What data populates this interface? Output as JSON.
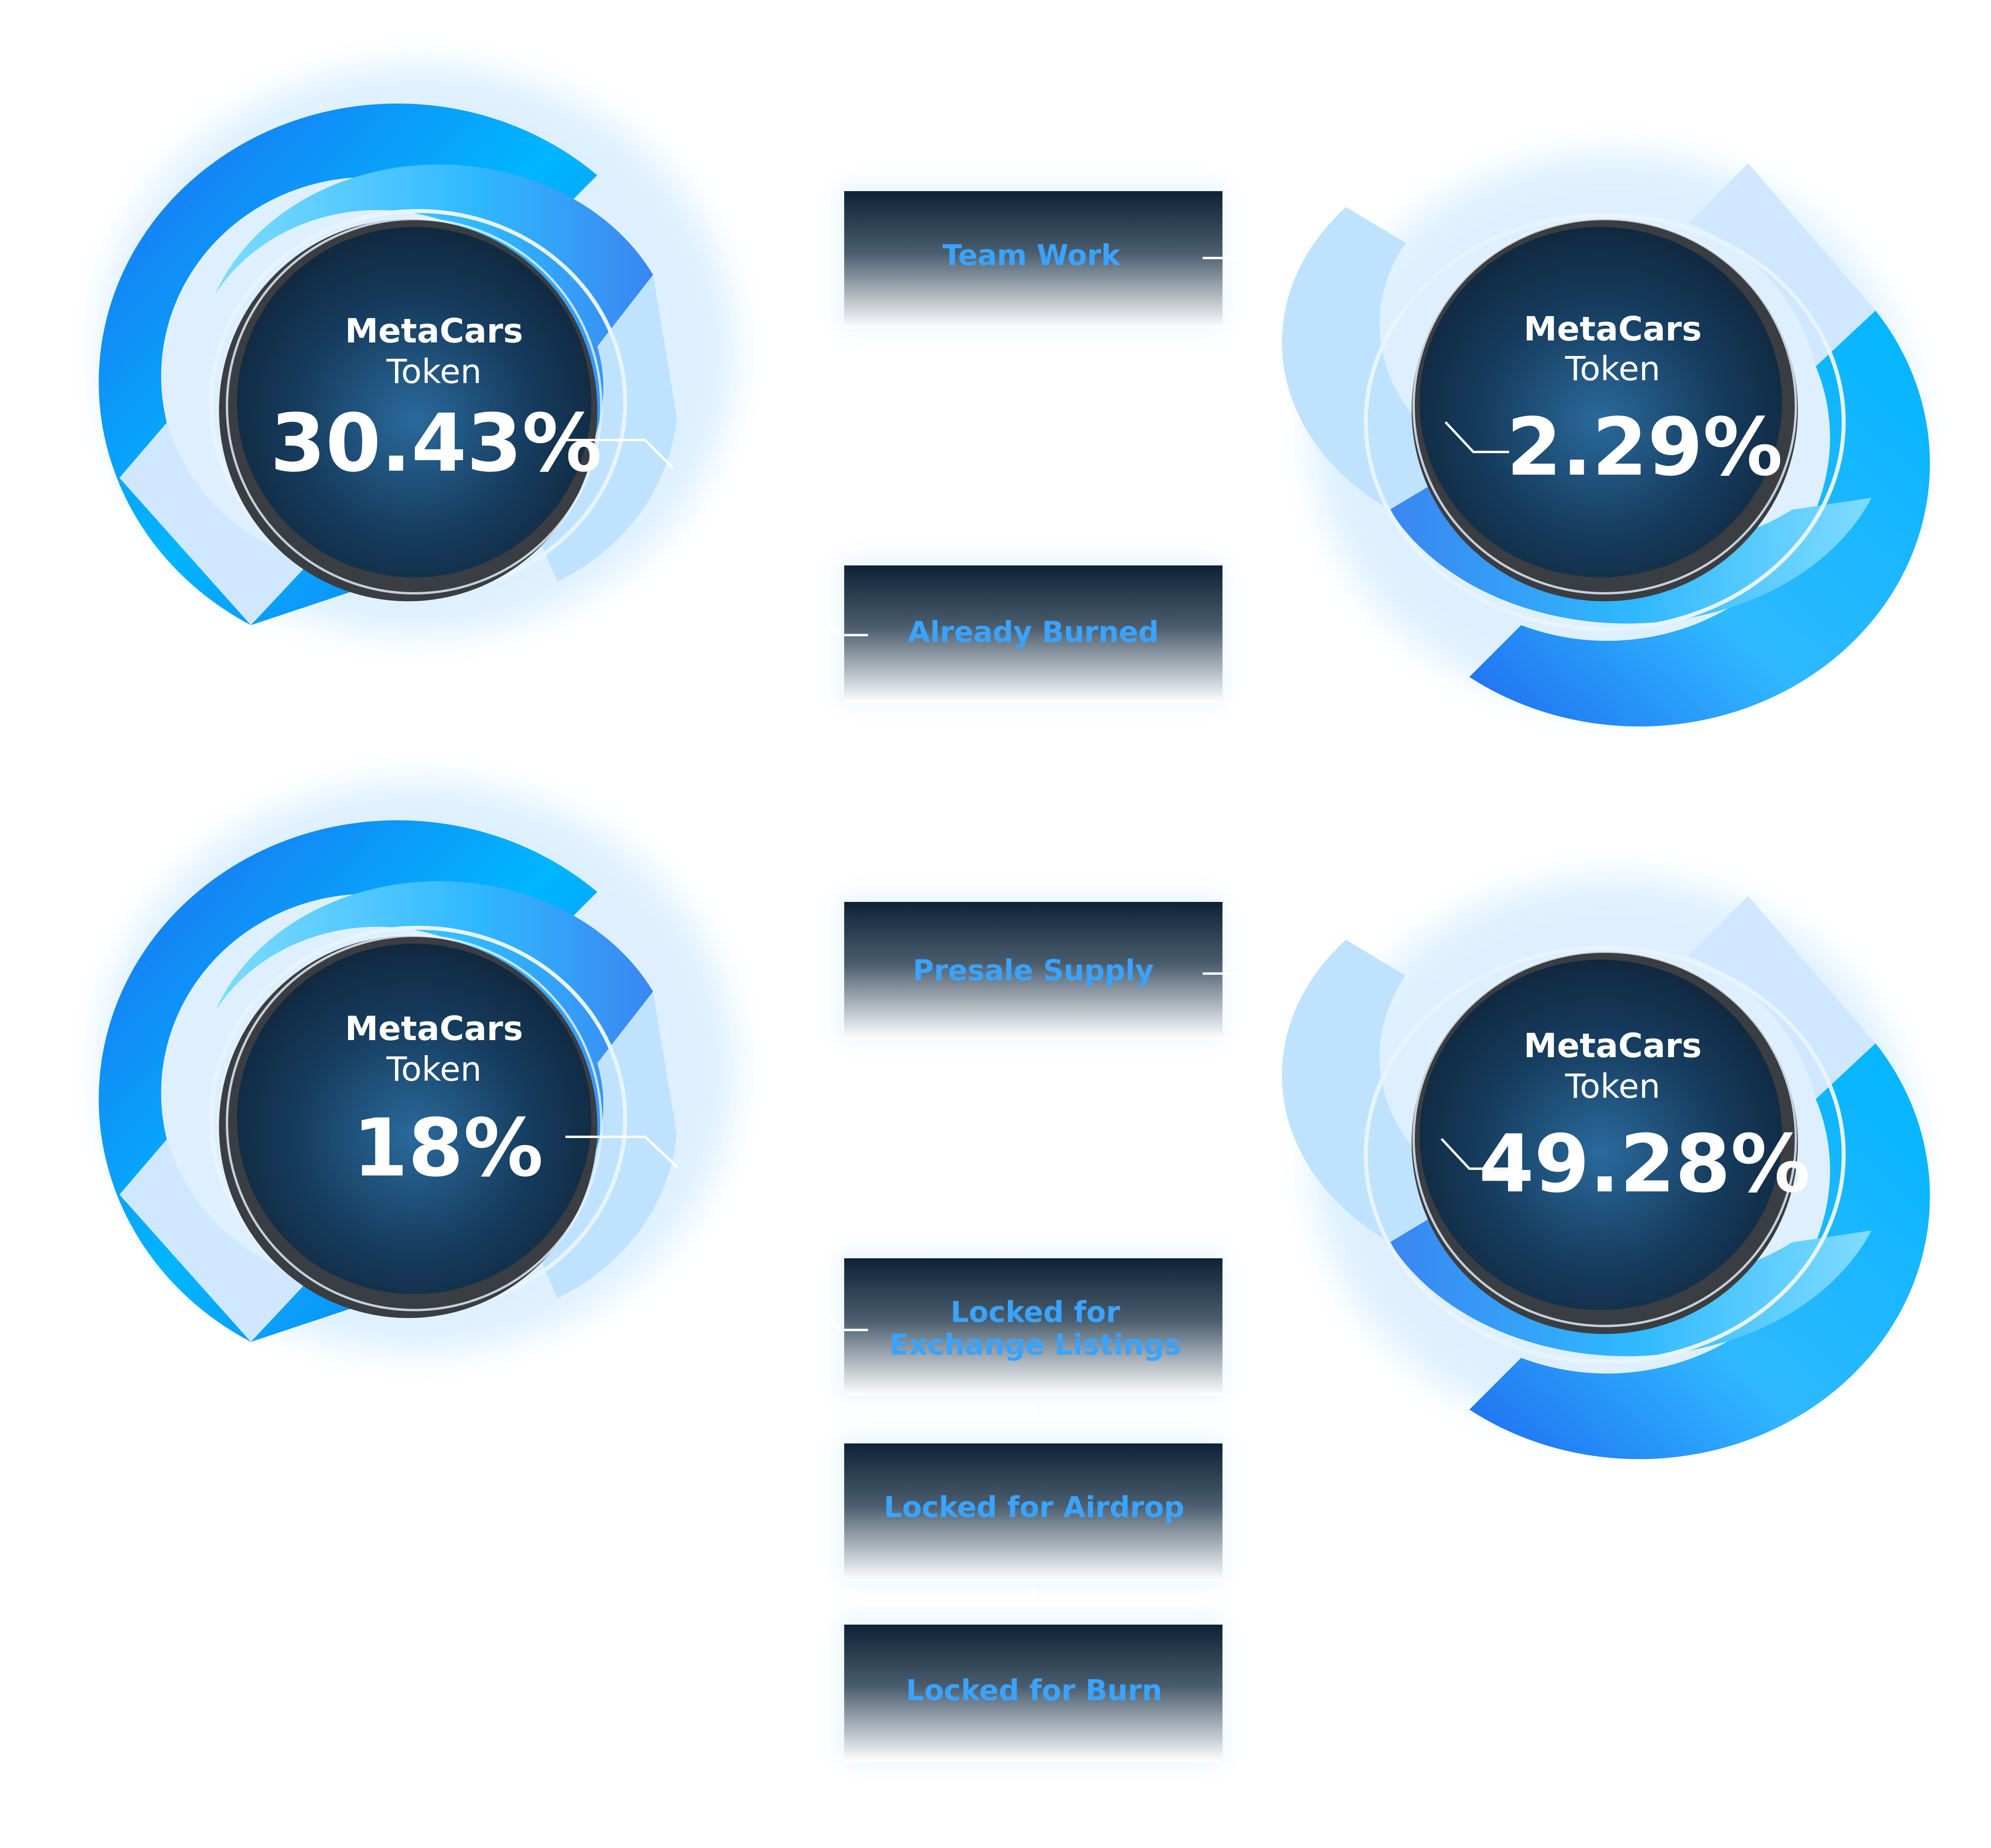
{
  "token_cards": [
    {
      "brand": "MetaCars",
      "unit": "Token",
      "percent_label": "30.43%",
      "share": 30.43,
      "category": "Team Work"
    },
    {
      "brand": "MetaCars",
      "unit": "Token",
      "percent_label": "2.29%",
      "share": 2.29,
      "category": "Already Burned"
    },
    {
      "brand": "MetaCars",
      "unit": "Token",
      "percent_label": "18%",
      "share": 18,
      "category": "Presale Supply"
    },
    {
      "brand": "MetaCars",
      "unit": "Token",
      "percent_label": "49.28%",
      "share": 49.28,
      "category": "Locked for Exchange Listings + Locked for Airdrop + Locked for Burn"
    }
  ],
  "categories": {
    "team_work": "Team Work",
    "already_burned": "Already Burned",
    "presale_supply": "Presale Supply",
    "locked_exchange_line1": "Locked for",
    "locked_exchange_line2": "Exchange Listings",
    "locked_airdrop": "Locked for Airdrop",
    "locked_burn": "Locked for Burn"
  },
  "colors": {
    "ring_deep": "#1e6cf0",
    "ring_mid": "#2fb8ff",
    "ring_light": "#bfe3ff",
    "disc_center": "#2a6a9c",
    "disc_edge": "#0f2438",
    "disc_rim": "#3a3d42",
    "label_blue": "#3aa3ff",
    "box_top": "#0d2236",
    "box_bottom": "#ffffff"
  }
}
